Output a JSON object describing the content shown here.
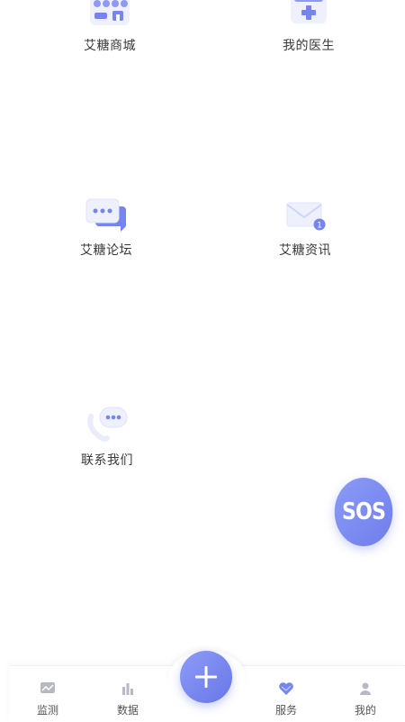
{
  "grid": {
    "items": [
      {
        "label": "艾糖商城",
        "icon": "store-icon"
      },
      {
        "label": "我的医生",
        "icon": "medical-kit-icon"
      },
      {
        "label": "艾糖论坛",
        "icon": "chat-bubble-icon"
      },
      {
        "label": "艾糖资讯",
        "icon": "mail-icon",
        "badge": "1"
      },
      {
        "label": "联系我们",
        "icon": "phone-chat-icon"
      }
    ]
  },
  "sos": {
    "label": "SOS"
  },
  "tabbar": {
    "tabs": [
      {
        "label": "监测",
        "icon": "monitor-icon"
      },
      {
        "label": "数据",
        "icon": "bar-chart-icon"
      },
      {
        "label": "服务",
        "icon": "heart-icon",
        "active": true
      },
      {
        "label": "我的",
        "icon": "user-icon"
      }
    ],
    "center_button": {
      "icon": "plus-icon"
    }
  },
  "colors": {
    "accent": "#7584ee",
    "accent_light": "#c9d0fb",
    "text": "#3a3a3a"
  }
}
